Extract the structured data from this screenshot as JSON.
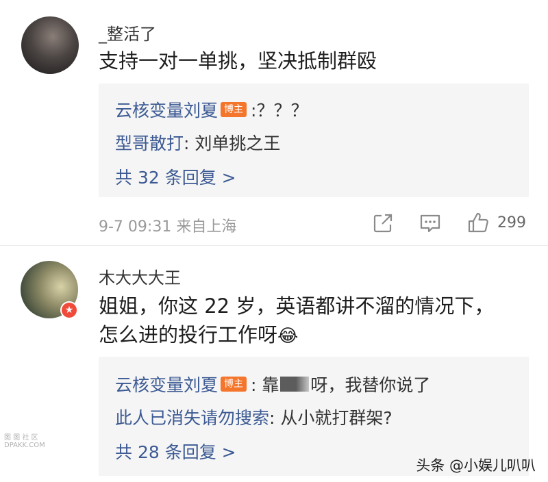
{
  "comments": [
    {
      "username": "_整活了",
      "text_lines": [
        "支持一对一单挑，坚决抵制群殴"
      ],
      "replies": [
        {
          "name": "云核变量刘夏",
          "tag": "博主",
          "text": ":？？？"
        },
        {
          "name": "型哥散打",
          "text": ": 刘单挑之王"
        }
      ],
      "more_replies": "共 32 条回复 >",
      "timestamp": "9-7 09:31 来自上海",
      "likes": "299"
    },
    {
      "username": "木大大大王",
      "text_lines": [
        "姐姐，你这 22 岁，英语都讲不溜的情况下，",
        "怎么进的投行工作呀"
      ],
      "emoji": "😂",
      "badge": "★",
      "replies": [
        {
          "name": "云核变量刘夏",
          "tag": "博主",
          "text_before": ": 靠",
          "text_after": "呀，我替你说了"
        },
        {
          "name": "此人已消失请勿搜索",
          "text": ": 从小就打群架?"
        }
      ],
      "more_replies": "共 28 条回复 >"
    }
  ],
  "watermark": "头条 @小娱儿叭叭",
  "watermark_left": [
    "图 图 社 区",
    "DPAKK.COM"
  ]
}
